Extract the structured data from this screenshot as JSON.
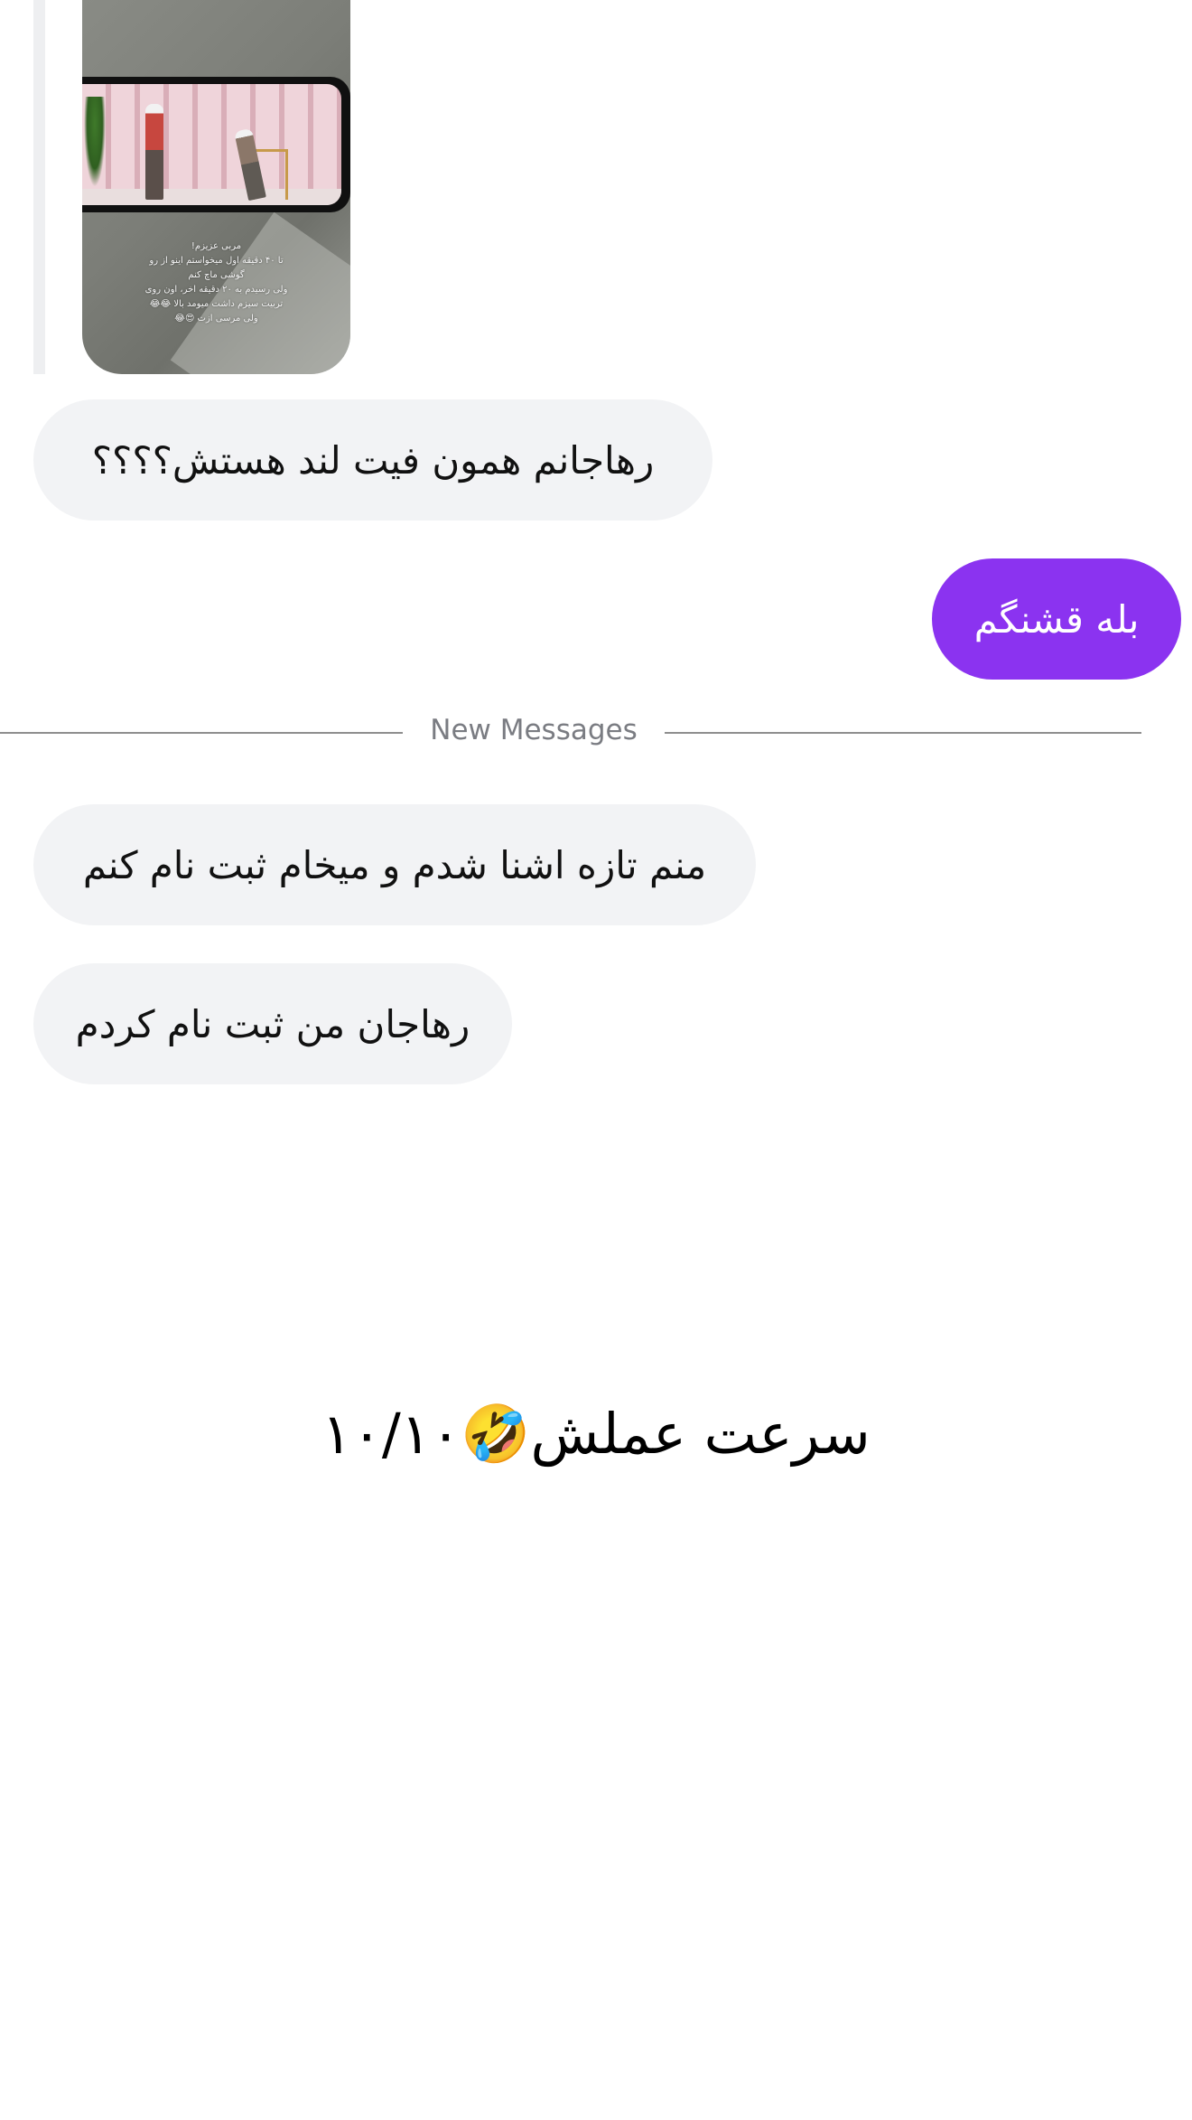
{
  "story": {
    "caption": "مربی عزیزم!\nتا ۴۰ دقیقه اول میخواستم اینو از رو\nگوشی ماچ کنم\nولی رسیدم به ۲۰ دقیقه اخر، اون روی\nتربیت سیزم داشت میومد بالا 😂😂\nولی مرسی ازت 😍😂"
  },
  "messages": [
    {
      "direction": "incoming",
      "text": "رهاجانم همون فیت لند هستش؟؟؟؟"
    },
    {
      "direction": "outgoing",
      "text": "بله قشنگم"
    },
    {
      "direction": "incoming",
      "text": "منم تازه اشنا شدم و میخام ثبت نام کنم"
    },
    {
      "direction": "incoming",
      "text": "رهاجان من ثبت نام کردم"
    }
  ],
  "divider": {
    "label": "New Messages"
  },
  "caption": "سرعت عملش🤣۱۰/۱۰",
  "colors": {
    "outgoing_bubble": "#8b33f0",
    "incoming_bubble": "#f2f3f5"
  }
}
